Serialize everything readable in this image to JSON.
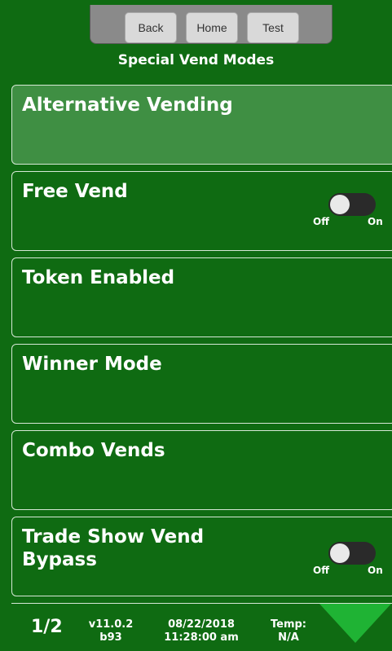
{
  "nav": {
    "back_label": "Back",
    "home_label": "Home",
    "test_label": "Test"
  },
  "page_title": "Special Vend Modes",
  "menu_items": [
    {
      "label": "Alternative Vending"
    },
    {
      "label": "Free Vend",
      "toggle": {
        "off_label": "Off",
        "on_label": "On",
        "state": "off"
      }
    },
    {
      "label": "Token Enabled"
    },
    {
      "label": "Winner Mode"
    },
    {
      "label": "Combo Vends"
    },
    {
      "label": "Trade Show Vend\nBypass",
      "toggle": {
        "off_label": "Off",
        "on_label": "On",
        "state": "off"
      }
    }
  ],
  "status_bar": {
    "page_indicator": "1/2",
    "version": "v11.0.2",
    "build": "b93",
    "date": "08/22/2018",
    "time": "11:28:00 am",
    "temp_label": "Temp:",
    "temp_value": "N/A"
  },
  "colors": {
    "background": "#0f6b12",
    "active_row": "#3f8f43",
    "arrow": "#1fb334"
  }
}
